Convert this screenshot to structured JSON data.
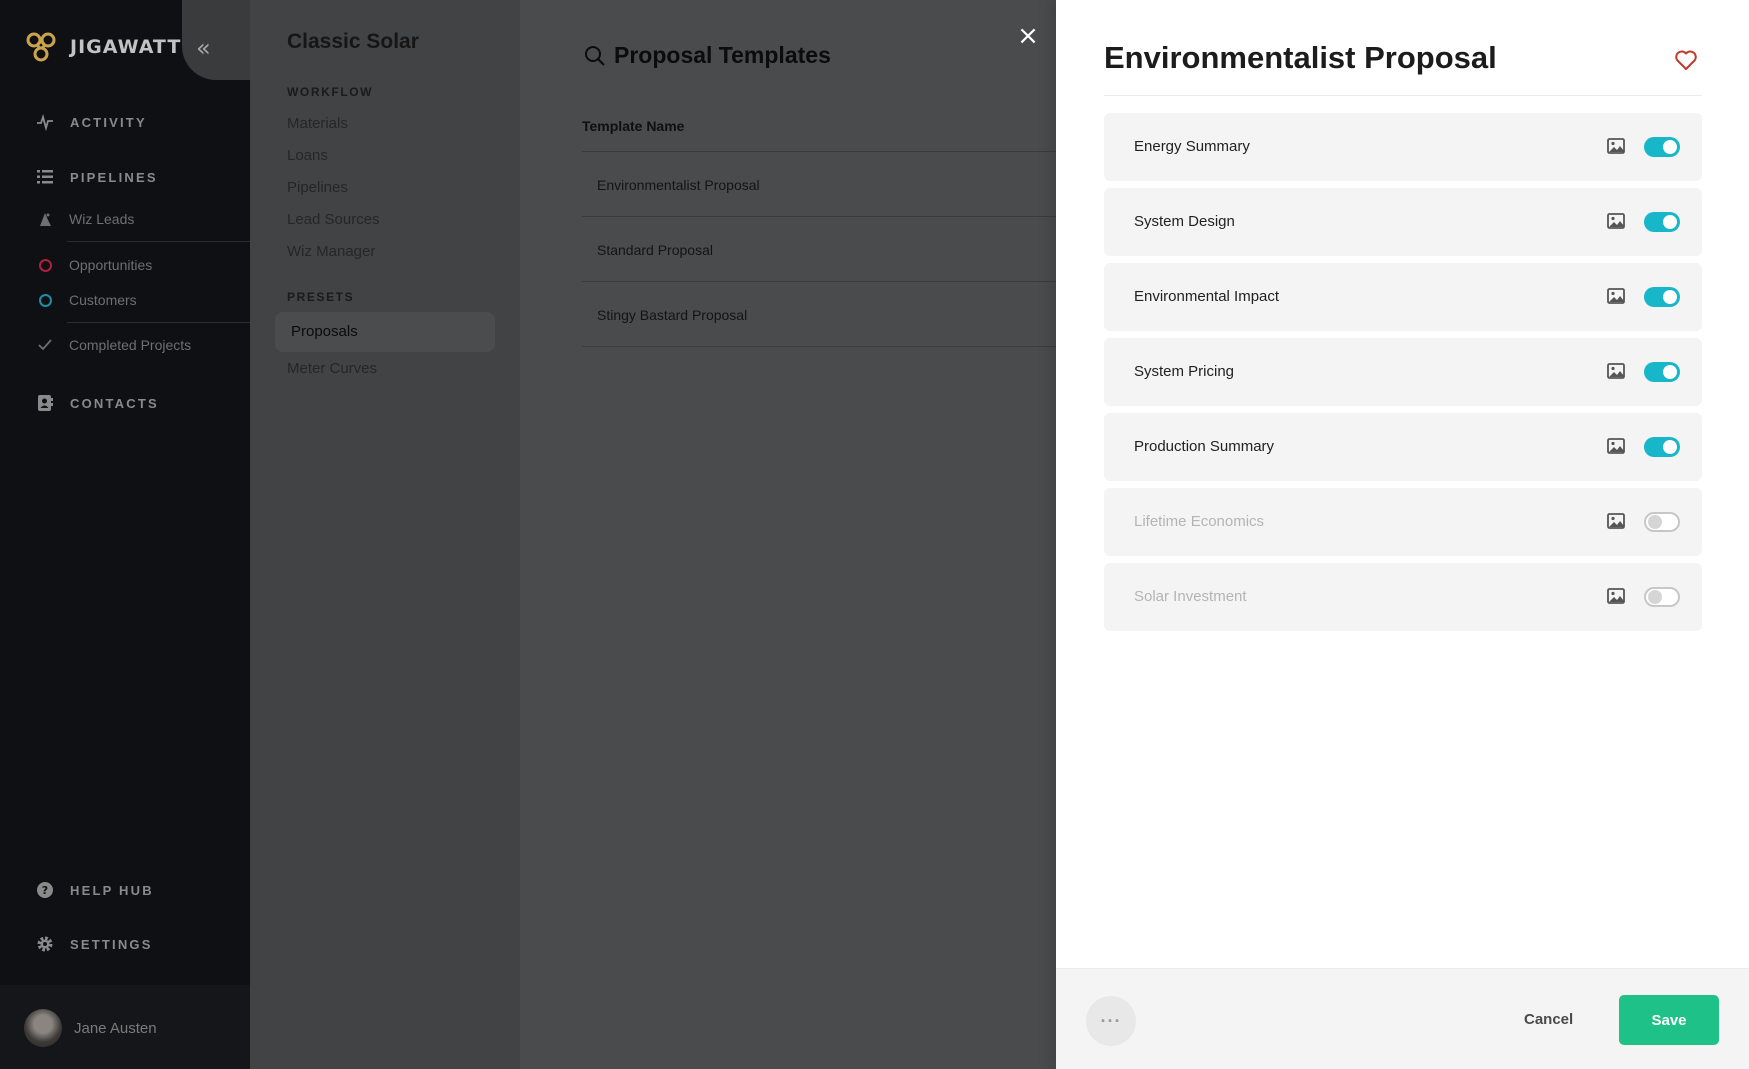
{
  "nav": {
    "brand": "JIGAWATT",
    "collapse_glyph": "«",
    "activity": "ACTIVITY",
    "pipelines": "PIPELINES",
    "wiz_leads": "Wiz Leads",
    "opportunities": "Opportunities",
    "customers": "Customers",
    "completed_projects": "Completed Projects",
    "contacts": "CONTACTS",
    "help_hub": "HELP HUB",
    "settings": "SETTINGS",
    "user_name": "Jane Austen",
    "colors": {
      "opportunities_ring": "#b0203c",
      "customers_ring": "#1c8fa8",
      "logo": "#c9a44e"
    },
    "icons": [
      "activity-icon",
      "pipelines-icon",
      "wiz-leads-icon",
      "check-icon",
      "contacts-icon",
      "help-icon",
      "gear-icon"
    ]
  },
  "menu": {
    "org_name": "Classic Solar",
    "workflow_heading": "WORKFLOW",
    "workflow_items": [
      "Materials",
      "Loans",
      "Pipelines",
      "Lead Sources",
      "Wiz Manager"
    ],
    "presets_heading": "PRESETS",
    "presets_items": [
      "Proposals",
      "Meter Curves"
    ]
  },
  "templates": {
    "title": "Proposal Templates",
    "column_header": "Template Name",
    "rows": [
      "Environmentalist Proposal",
      "Standard Proposal",
      "Stingy Bastard Proposal"
    ],
    "close_glyph": "×"
  },
  "drawer": {
    "title": "Environmentalist Proposal",
    "sections": [
      {
        "label": "Energy Summary",
        "enabled": true
      },
      {
        "label": "System Design",
        "enabled": true
      },
      {
        "label": "Environmental Impact",
        "enabled": true
      },
      {
        "label": "System Pricing",
        "enabled": true
      },
      {
        "label": "Production Summary",
        "enabled": true
      },
      {
        "label": "Lifetime Economics",
        "enabled": false
      },
      {
        "label": "Solar Investment",
        "enabled": false
      }
    ],
    "more_glyph": "···",
    "cancel": "Cancel",
    "save": "Save",
    "colors": {
      "toggle_on": "#17b6c9",
      "save": "#1ec188",
      "favorite": "#c0392b"
    }
  }
}
